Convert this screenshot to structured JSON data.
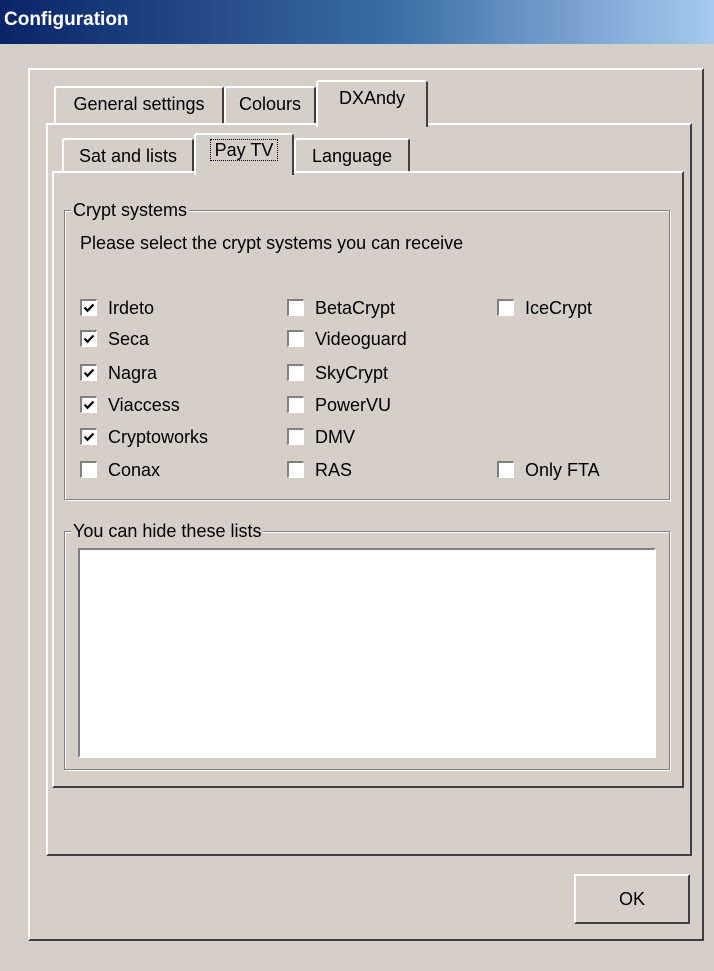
{
  "window": {
    "title": "Configuration"
  },
  "main_tabs": [
    {
      "label": "General settings"
    },
    {
      "label": "Colours"
    },
    {
      "label": "DXAndy",
      "active": true
    }
  ],
  "sub_tabs": [
    {
      "label": "Sat and lists"
    },
    {
      "label": "Pay TV",
      "active": true
    },
    {
      "label": "Language"
    }
  ],
  "crypt_group": {
    "title": "Crypt systems",
    "instruction": "Please select the crypt systems you can receive",
    "checkboxes": [
      {
        "label": "Irdeto",
        "checked": true
      },
      {
        "label": "Seca",
        "checked": true
      },
      {
        "label": "Nagra",
        "checked": true
      },
      {
        "label": "Viaccess",
        "checked": true
      },
      {
        "label": "Cryptoworks",
        "checked": true
      },
      {
        "label": "Conax",
        "checked": false
      },
      {
        "label": "BetaCrypt",
        "checked": false
      },
      {
        "label": "Videoguard",
        "checked": false
      },
      {
        "label": "SkyCrypt",
        "checked": false
      },
      {
        "label": "PowerVU",
        "checked": false
      },
      {
        "label": "DMV",
        "checked": false
      },
      {
        "label": "RAS",
        "checked": false
      },
      {
        "label": "IceCrypt",
        "checked": false
      },
      {
        "label": "Only FTA",
        "checked": false
      }
    ]
  },
  "hide_group": {
    "title": "You can hide these lists"
  },
  "buttons": {
    "ok": "OK"
  }
}
